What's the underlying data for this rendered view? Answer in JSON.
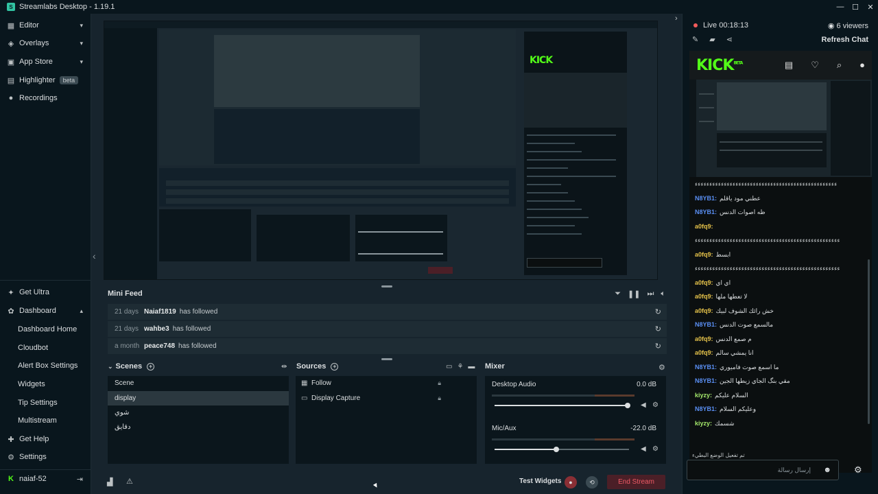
{
  "window": {
    "title": "Streamlabs Desktop - 1.19.1",
    "controls": [
      "—",
      "☐",
      "✕"
    ]
  },
  "sidebar": {
    "top_items": [
      {
        "label": "Editor",
        "icon": "editor-icon"
      },
      {
        "label": "Overlays",
        "icon": "overlays-icon"
      },
      {
        "label": "App Store",
        "icon": "app-store-icon"
      },
      {
        "label": "Highlighter",
        "icon": "highlighter-icon",
        "badge": "beta"
      },
      {
        "label": "Recordings",
        "icon": "recordings-icon"
      }
    ],
    "bottom_items": {
      "get_ultra": "Get Ultra",
      "dashboard": "Dashboard",
      "dashboard_sub": [
        "Dashboard Home",
        "Cloudbot",
        "Alert Box Settings",
        "Widgets",
        "Tip Settings",
        "Multistream"
      ],
      "get_help": "Get Help",
      "settings": "Settings",
      "account": "naiaf-52"
    }
  },
  "mini_feed": {
    "title": "Mini Feed",
    "rows": [
      {
        "time": "21 days",
        "user": "Naiaf1819",
        "action": "has followed"
      },
      {
        "time": "21 days",
        "user": "wahbe3",
        "action": "has followed"
      },
      {
        "time": "a month",
        "user": "peace748",
        "action": "has followed"
      }
    ]
  },
  "scenes": {
    "title": "Scenes",
    "items": [
      "Scene",
      "display",
      "شوي",
      "دقايق"
    ],
    "active_index": 1
  },
  "sources": {
    "title": "Sources",
    "items": [
      {
        "label": "Follow",
        "icon": "follow-icon"
      },
      {
        "label": "Display Capture",
        "icon": "monitor-icon"
      }
    ]
  },
  "mixer": {
    "title": "Mixer",
    "channels": [
      {
        "label": "Desktop Audio",
        "value": "0.0 dB",
        "volume": 0.99
      },
      {
        "label": "Mic/Aux",
        "value": "-22.0 dB",
        "volume": 0.46
      }
    ]
  },
  "footer": {
    "test_widgets": "Test Widgets",
    "end_stream": "End Stream"
  },
  "chat_panel": {
    "live_label": "Live 00:18:13",
    "viewers": "6 viewers",
    "refresh": "Refresh Chat",
    "kick_logo": "KICK",
    "kick_badge": "BETA",
    "messages": [
      {
        "user": "",
        "text": "ءءءءءءءءءءءءءءءءءءءءءءءءءءءءءءءءءءءءءءءءءءءءءءءءء",
        "color": "none"
      },
      {
        "user": "N8YB1:",
        "text": "عطني مود ياقلم",
        "color": "blue"
      },
      {
        "user": "N8YB1:",
        "text": "ظه اصوات الدنس",
        "color": "blue"
      },
      {
        "user": "a0fq9:",
        "text": "",
        "color": "yellow"
      },
      {
        "user": "",
        "text": "ءءءءءءءءءءءءءءءءءءءءءءءءءءءءءءءءءءءءءءءءءءءءءءءءءء",
        "color": "none"
      },
      {
        "user": "a0fq9:",
        "text": "ابسط",
        "color": "yellow"
      },
      {
        "user": "",
        "text": "ءءءءءءءءءءءءءءءءءءءءءءءءءءءءءءءءءءءءءءءءءءءءءءءءءء",
        "color": "none"
      },
      {
        "user": "a0fq9:",
        "text": "اي اي",
        "color": "yellow"
      },
      {
        "user": "a0fq9:",
        "text": "لا تعطها ملها",
        "color": "yellow"
      },
      {
        "user": "a0fq9:",
        "text": "خش رائك الشوف لبيك",
        "color": "yellow"
      },
      {
        "user": "N8YB1:",
        "text": "مالسمع صوت الدنس",
        "color": "blue"
      },
      {
        "user": "a0fq9:",
        "text": "م صمع الدنس",
        "color": "yellow"
      },
      {
        "user": "a0fq9:",
        "text": "انا يمشي سالم",
        "color": "yellow"
      },
      {
        "user": "N8YB1:",
        "text": "ما اسمع صوت فاميوري",
        "color": "blue"
      },
      {
        "user": "N8YB1:",
        "text": "مقي بنگ الجاي زيطها الجين",
        "color": "blue"
      },
      {
        "user": "kiyzy:",
        "text": "السلام عليكم",
        "color": "green"
      },
      {
        "user": "N8YB1:",
        "text": "وعليكم السلام",
        "color": "blue"
      },
      {
        "user": "kiyzy:",
        "text": "شسمك",
        "color": "green"
      }
    ],
    "note": "تم تفعيل الوضع البطيء",
    "input_placeholder": "إرسال رسالة"
  }
}
